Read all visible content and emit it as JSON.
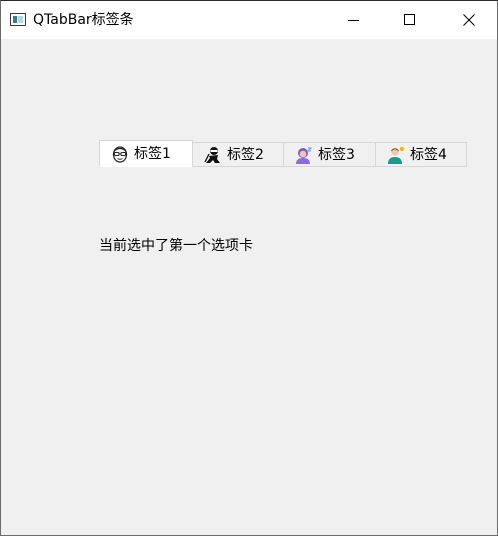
{
  "window": {
    "title": "QTabBar标签条"
  },
  "tabs": [
    {
      "label": "标签1",
      "icon": "glasses-face-icon",
      "selected": true
    },
    {
      "label": "标签2",
      "icon": "ninja-icon",
      "selected": false
    },
    {
      "label": "标签3",
      "icon": "woman-sleeping-icon",
      "selected": false
    },
    {
      "label": "标签4",
      "icon": "man-idea-icon",
      "selected": false
    }
  ],
  "status_text": "当前选中了第一个选项卡",
  "colors": {
    "window_bg": "#f0f0f0",
    "titlebar_bg": "#ffffff",
    "tab_border": "#d6d6d6",
    "selected_tab_bg": "#ffffff"
  }
}
